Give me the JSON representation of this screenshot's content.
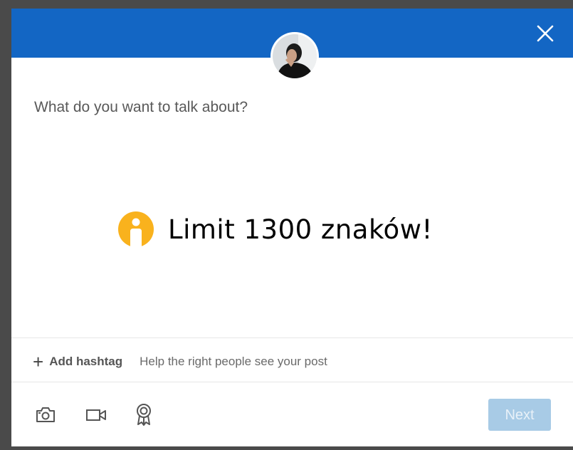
{
  "dialog": {
    "close_icon": "close-icon",
    "avatar_icon": "profile-avatar"
  },
  "composer": {
    "placeholder": "What do you want to talk about?"
  },
  "overlay": {
    "icon": "info-icon",
    "icon_color": "#f9b21d",
    "text": "Limit 1300 znaków!"
  },
  "hashtag": {
    "add_label": "Add hashtag",
    "hint": "Help the right people see your post"
  },
  "toolbar": {
    "icons": [
      "camera-icon",
      "video-icon",
      "award-icon"
    ],
    "next_label": "Next"
  },
  "colors": {
    "header": "#1366c4",
    "next_disabled": "#a8cbe6"
  }
}
